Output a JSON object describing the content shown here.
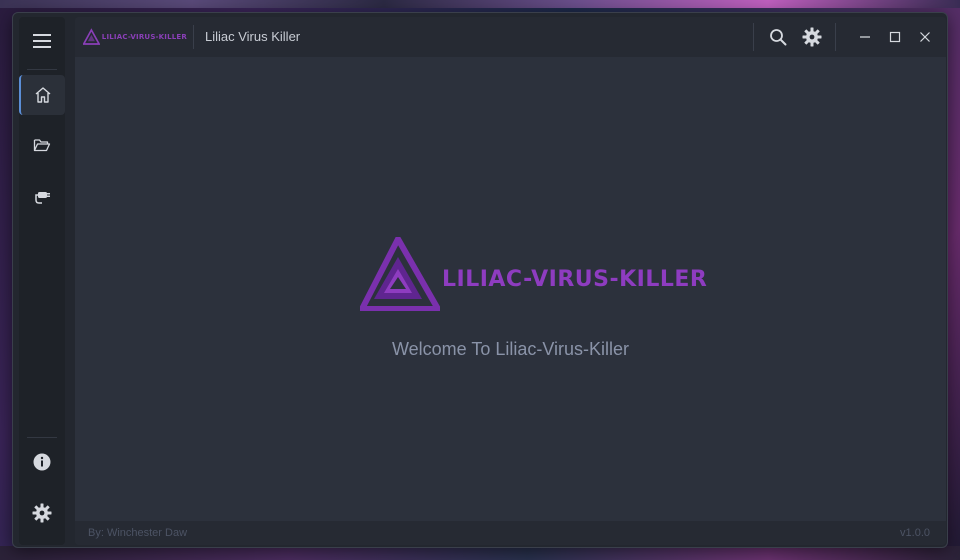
{
  "app": {
    "title": "Liliac Virus Killer",
    "logo_text": "LILIAC-VIRUS-KILLER",
    "accent": "#8e3cc0",
    "nav_accent": "#5b8ed6"
  },
  "sidebar": {
    "items": [
      {
        "name": "menu",
        "icon": "hamburger-menu-icon"
      },
      {
        "name": "home",
        "icon": "home-icon",
        "active": true
      },
      {
        "name": "scan-folder",
        "icon": "folder-open-icon"
      },
      {
        "name": "plugins",
        "icon": "plug-icon"
      },
      {
        "name": "info",
        "icon": "info-icon"
      },
      {
        "name": "settings",
        "icon": "gear-icon"
      }
    ]
  },
  "titlebar": {
    "actions": [
      {
        "name": "search",
        "icon": "search-icon"
      },
      {
        "name": "settings",
        "icon": "gear-icon"
      },
      {
        "name": "minimize",
        "icon": "minimize-icon"
      },
      {
        "name": "maximize",
        "icon": "maximize-icon"
      },
      {
        "name": "close",
        "icon": "close-icon"
      }
    ]
  },
  "main": {
    "welcome": "Welcome To Liliac-Virus-Killer"
  },
  "footer": {
    "author": "By: Winchester Daw",
    "version": "v1.0.0"
  }
}
